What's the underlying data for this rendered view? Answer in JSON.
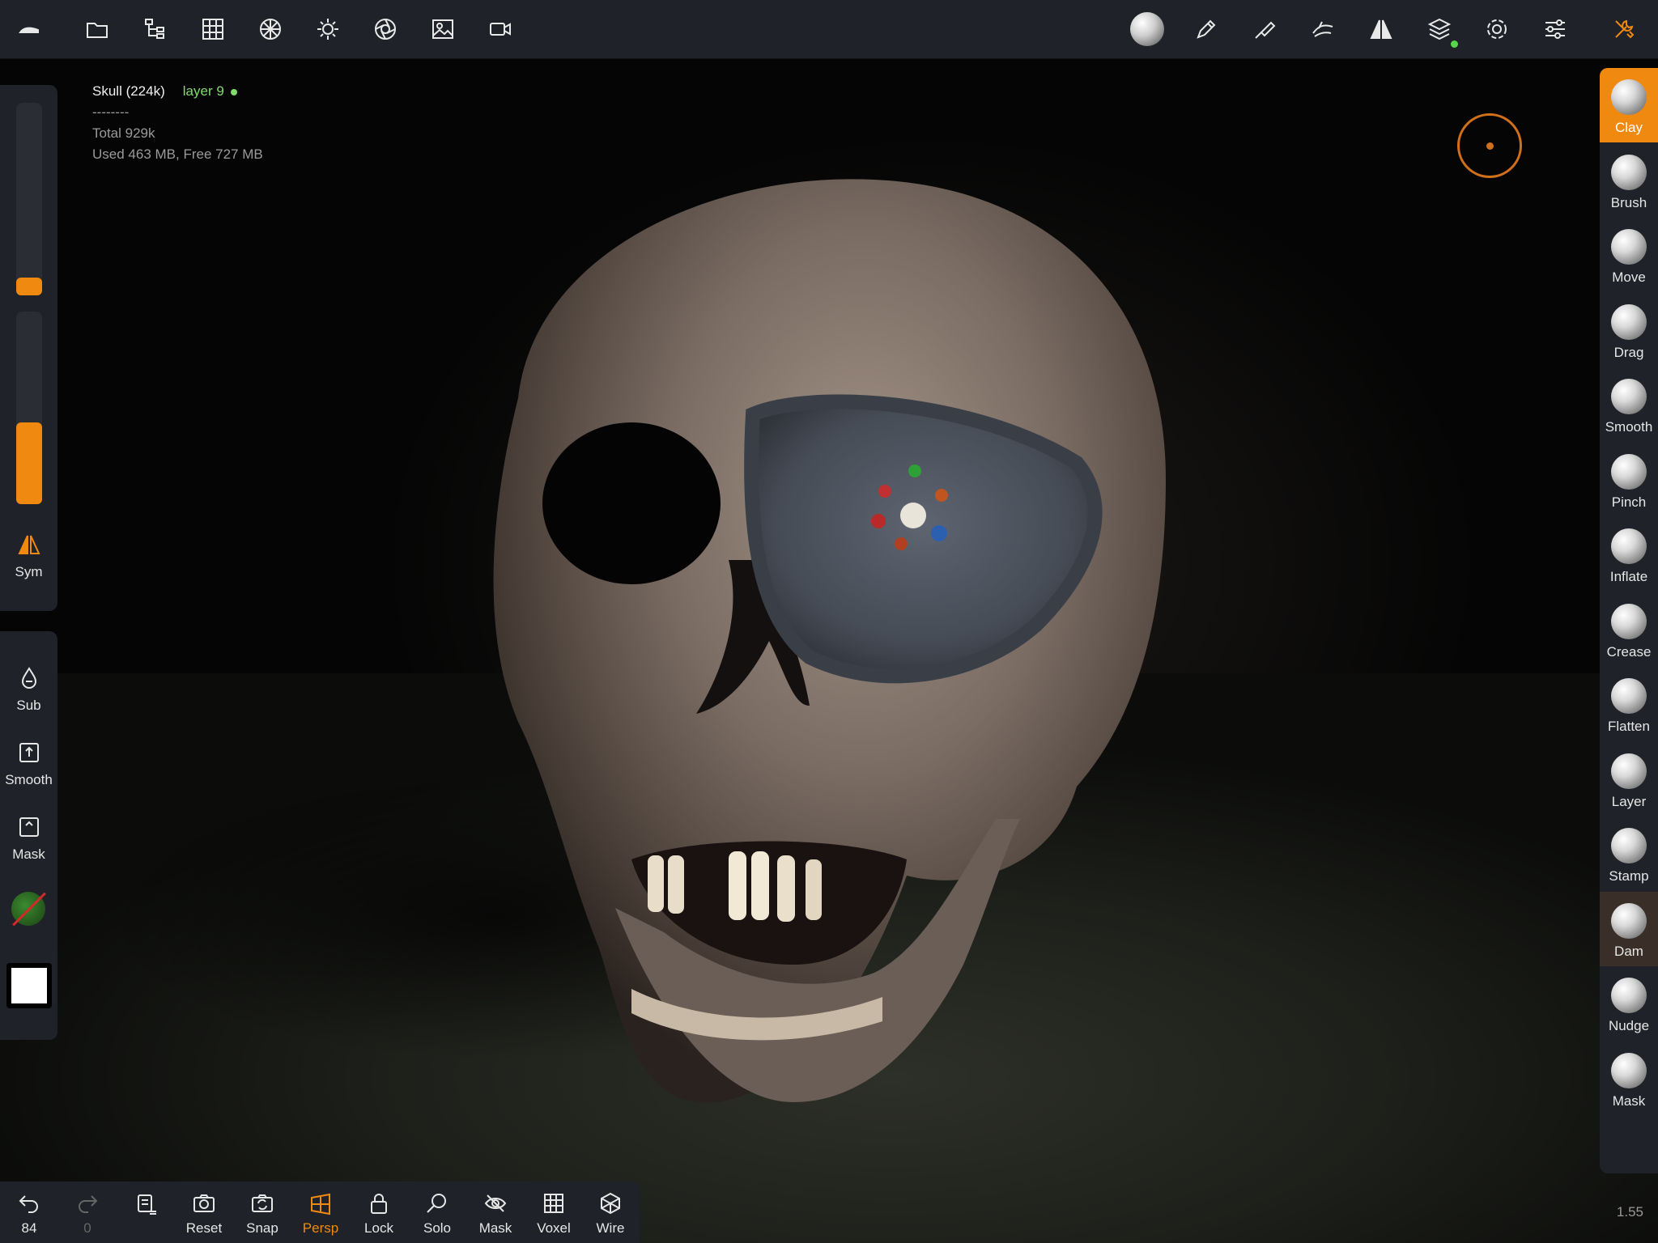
{
  "info": {
    "mesh": "Skull (224k)",
    "layer": "layer 9",
    "separator": "--------",
    "total": "Total 929k",
    "memory": "Used 463 MB,  Free 727 MB"
  },
  "left_tools": {
    "sym": "Sym",
    "sub": "Sub",
    "smooth": "Smooth",
    "mask": "Mask"
  },
  "sliders": {
    "radius_value": 0.05,
    "intensity_value": 0.5
  },
  "brushes": [
    "Clay",
    "Brush",
    "Move",
    "Drag",
    "Smooth",
    "Pinch",
    "Inflate",
    "Crease",
    "Flatten",
    "Layer",
    "Stamp",
    "Dam",
    "Nudge",
    "Mask"
  ],
  "bottom": {
    "undo_count": "84",
    "redo_count": "0",
    "reset": "Reset",
    "snap": "Snap",
    "persp": "Persp",
    "lock": "Lock",
    "solo": "Solo",
    "mask": "Mask",
    "voxel": "Voxel",
    "wire": "Wire"
  },
  "version": "1.55",
  "colors": {
    "accent": "#f0890f",
    "layer_green": "#7fdc6a",
    "panel": "#1f2229"
  }
}
